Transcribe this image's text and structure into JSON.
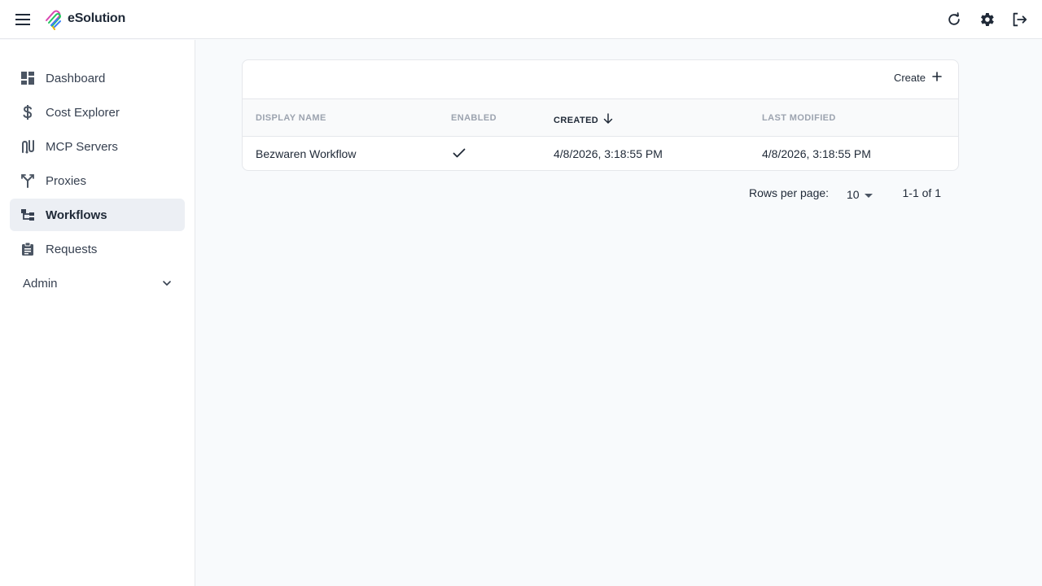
{
  "app": {
    "title": "eSolution"
  },
  "header": {
    "menu_icon": "hamburger-menu-icon",
    "actions": [
      {
        "icon": "refresh-icon"
      },
      {
        "icon": "gear-icon"
      },
      {
        "icon": "logout-icon"
      }
    ]
  },
  "sidebar": {
    "items": [
      {
        "label": "Dashboard",
        "icon": "dashboard-icon"
      },
      {
        "label": "Cost Explorer",
        "icon": "dollar-icon"
      },
      {
        "label": "MCP Servers",
        "icon": "mcp-servers-icon"
      },
      {
        "label": "Proxies",
        "icon": "fork-icon"
      },
      {
        "label": "Workflows",
        "icon": "workflow-icon",
        "active": true
      },
      {
        "label": "Requests",
        "icon": "clipboard-icon"
      }
    ],
    "groups": [
      {
        "label": "Admin",
        "icon": "chevron-down-icon",
        "expanded": false
      }
    ]
  },
  "table": {
    "toolbar": {
      "create_label": "Create"
    },
    "columns": [
      {
        "label": "DISPLAY NAME"
      },
      {
        "label": "ENABLED"
      },
      {
        "label": "CREATED",
        "sorted": "desc"
      },
      {
        "label": "LAST MODIFIED"
      }
    ],
    "rows": [
      {
        "display_name": "Bezwaren Workflow",
        "enabled": true,
        "created": "4/8/2026, 3:18:55 PM",
        "last_modified": "4/8/2026, 3:18:55 PM"
      }
    ]
  },
  "pagination": {
    "rows_per_page_label": "Rows per page:",
    "rows_per_page_value": "10",
    "range": "1-1 of 1"
  },
  "colors": {
    "active_nav_bg": "#eceff4",
    "border": "#e5e7eb",
    "page_bg": "#f8fafc",
    "muted_header": "#9ca3af"
  }
}
